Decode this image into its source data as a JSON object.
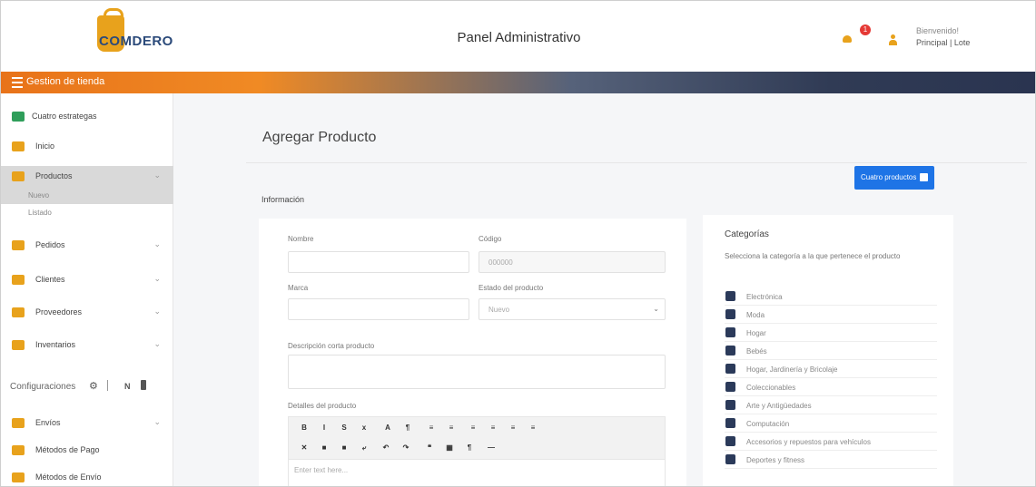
{
  "header": {
    "logo_text": "COMDERO",
    "title": "Panel Administrativo",
    "notification_count": "1",
    "user_greeting": "Bienvenido!",
    "user_role": "Principal | Lote"
  },
  "topbar": {
    "label": "Gestion de tienda"
  },
  "sidebar": {
    "store_item": "Cuatro estrategas",
    "items": [
      {
        "label": "Inicio"
      },
      {
        "label": "Productos"
      },
      {
        "label": "Pedidos"
      },
      {
        "label": "Clientes"
      },
      {
        "label": "Proveedores"
      },
      {
        "label": "Inventarios"
      }
    ],
    "sub_items": [
      "Nuevo",
      "Listado"
    ],
    "config_label": "Configuraciones",
    "config_items": [
      {
        "label": "Envíos"
      },
      {
        "label": "Métodos de Pago"
      },
      {
        "label": "Métodos de Envío"
      }
    ]
  },
  "main": {
    "page_title": "Agregar Producto",
    "back_button": "Cuatro productos",
    "section_title": "Información",
    "form": {
      "name_label": "Nombre",
      "name_value": "",
      "code_label": "Código",
      "code_value": "000000",
      "brand_label": "Marca",
      "brand_value": "",
      "status_label": "Estado del producto",
      "status_value": "Nuevo",
      "short_desc_label": "Descripción corta producto",
      "details_label": "Detalles del producto",
      "editor_placeholder": "Enter text here...",
      "toolbar_row1": [
        "B",
        "I",
        "S",
        "x",
        "A",
        "¶",
        "≡",
        "≡",
        "≡",
        "≡",
        "≡",
        "≡"
      ],
      "toolbar_row2": [
        "✕",
        "■",
        "■",
        "⤶",
        "↶",
        "↷",
        "❝",
        "▦",
        "¶",
        "—"
      ]
    },
    "categories": {
      "title": "Categorías",
      "description": "Selecciona la categoría a la que pertenece el producto",
      "items": [
        "Electrónica",
        "Moda",
        "Hogar",
        "Bebés",
        "Hogar, Jardinería y Bricolaje",
        "Coleccionables",
        "Arte y Antigüedades",
        "Computación",
        "Accesorios y repuestos para vehículos",
        "Deportes y fitness"
      ]
    }
  }
}
